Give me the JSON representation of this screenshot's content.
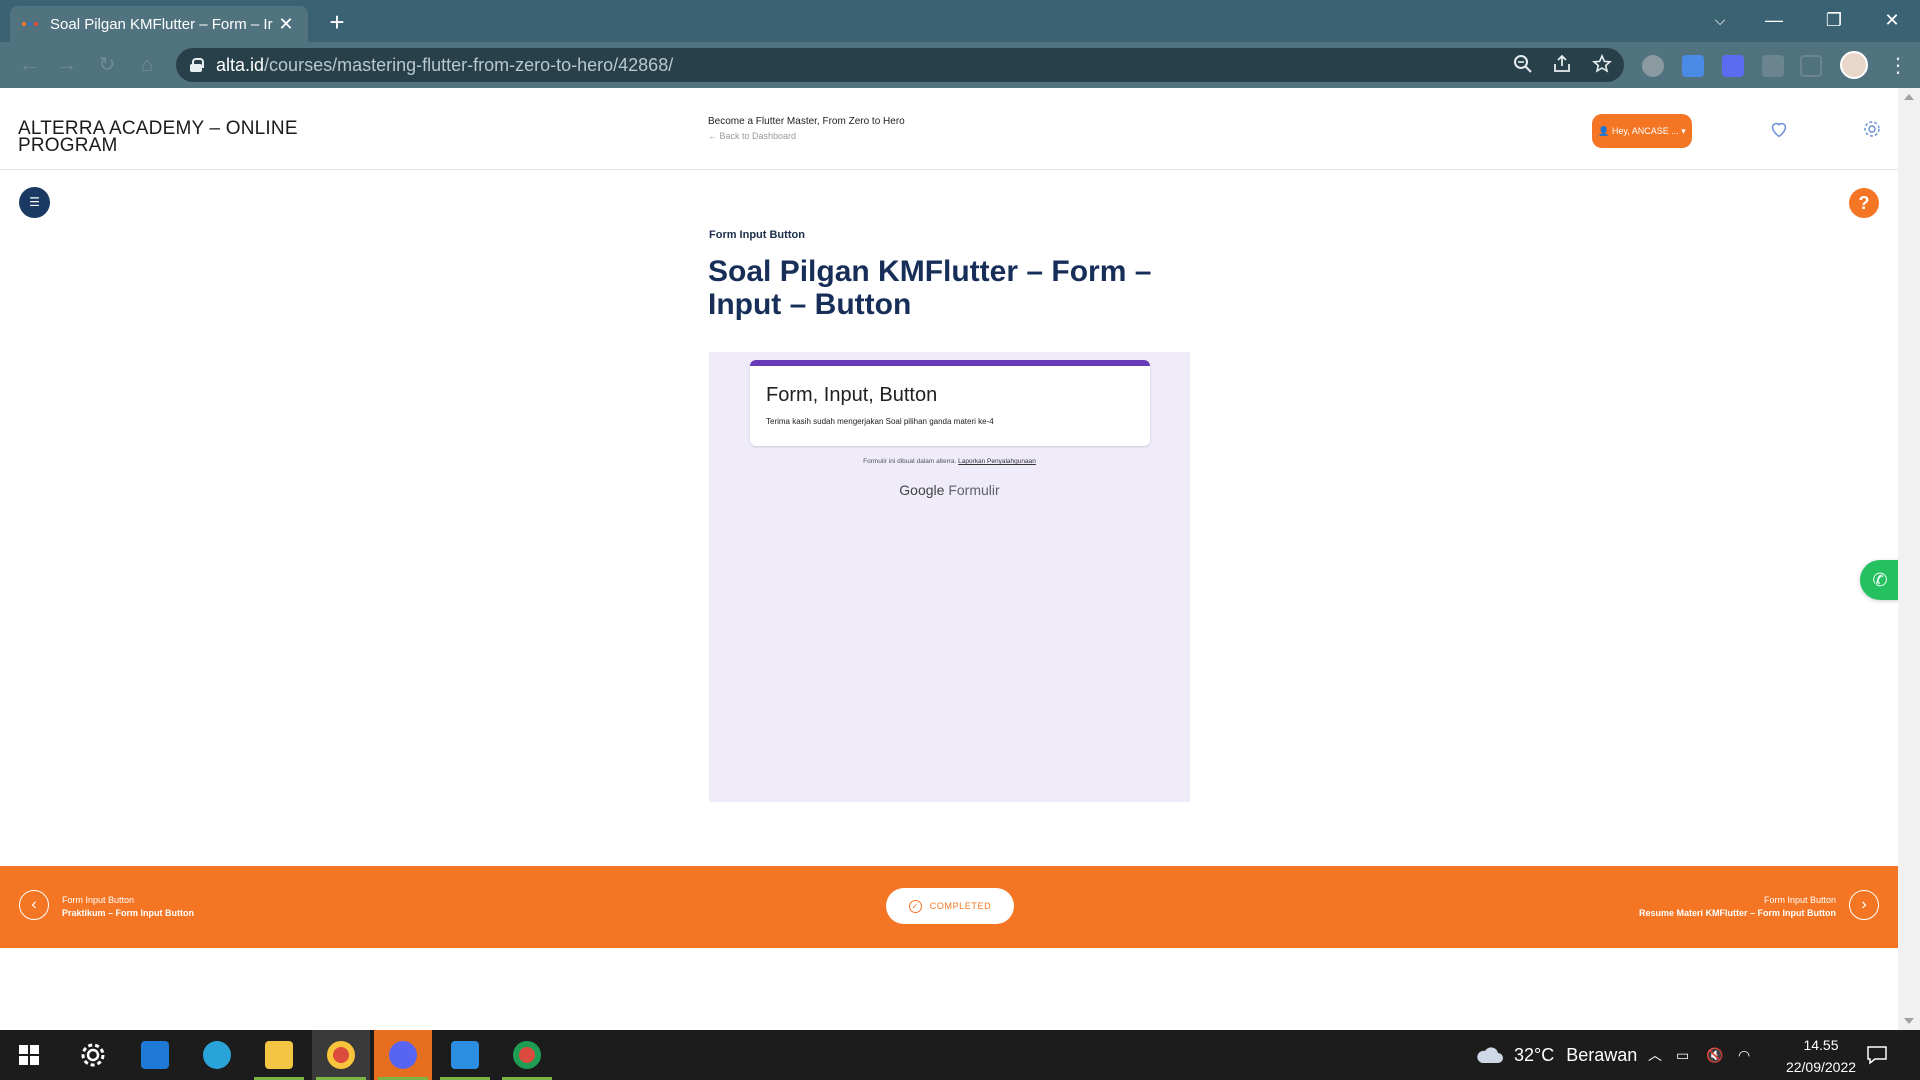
{
  "browser": {
    "tab_title": "Soal Pilgan KMFlutter – Form – Ir",
    "tab_close": "✕",
    "new_tab": "+",
    "url_host": "alta.id",
    "url_path": "/courses/mastering-flutter-from-zero-to-hero/42868/",
    "window_controls": {
      "collapse": "⌵",
      "minimize": "—",
      "restore": "❐",
      "close": "✕"
    }
  },
  "header": {
    "brand": "ALTERRA ACADEMY – ONLINE PROGRAM",
    "course_title": "Become a Flutter Master, From Zero to Hero",
    "back_link": "← Back to Dashboard",
    "user_button": "👤 Hey, ANCASE ... ▾"
  },
  "lesson": {
    "category": "Form Input Button",
    "title": "Soal Pilgan KMFlutter – Form – Input – Button"
  },
  "embedded_form": {
    "title": "Form, Input, Button",
    "description": "Terima kasih sudah mengerjakan Soal pilihan ganda materi ke-4",
    "footer_text": "Formulir ini dibuat dalam alterra.",
    "abuse_link": "Laporkan Penyalahgunaan",
    "brand_google": "Google",
    "brand_forms": "Formulir"
  },
  "footer_nav": {
    "prev_category": "Form Input Button",
    "prev_title": "Praktikum – Form Input Button",
    "status": "COMPLETED",
    "next_category": "Form Input Button",
    "next_title": "Resume Materi KMFlutter – Form Input Button"
  },
  "taskbar": {
    "weather_temp": "32°C",
    "weather_desc": "Berawan",
    "time": "14.55",
    "date": "22/09/2022"
  },
  "colors": {
    "accent_orange": "#f47624",
    "navy": "#172f58",
    "form_purple": "#673ab7",
    "whatsapp_green": "#25c160"
  }
}
